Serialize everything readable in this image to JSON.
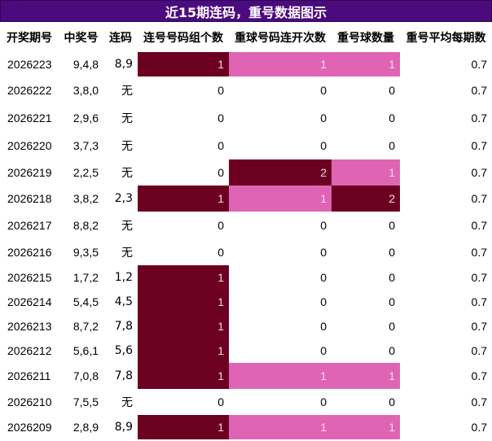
{
  "title": "近15期连码，重号数据图示",
  "columns": [
    "开奖期号",
    "中奖号",
    "连码",
    "连号号码组个数",
    "重球号码连开次数",
    "重号球数量",
    "重号平均每期数"
  ],
  "rows": [
    {
      "issue": "2026223",
      "numbers": "9,4,8",
      "consec": "8,9",
      "consec_groups": "1",
      "repeat_runs": "1",
      "repeat_count": "1",
      "repeat_avg": "0.7",
      "hl": [
        "dark",
        "pink",
        "pink"
      ]
    },
    {
      "issue": "2026222",
      "numbers": "3,8,0",
      "consec": "无",
      "consec_groups": "0",
      "repeat_runs": "0",
      "repeat_count": "0",
      "repeat_avg": "0.7",
      "hl": [
        "",
        "",
        ""
      ]
    },
    {
      "issue": "2026221",
      "numbers": "2,9,6",
      "consec": "无",
      "consec_groups": "0",
      "repeat_runs": "0",
      "repeat_count": "0",
      "repeat_avg": "0.7",
      "hl": [
        "",
        "",
        ""
      ]
    },
    {
      "issue": "2026220",
      "numbers": "3,7,3",
      "consec": "无",
      "consec_groups": "0",
      "repeat_runs": "0",
      "repeat_count": "0",
      "repeat_avg": "0.7",
      "hl": [
        "",
        "",
        ""
      ]
    },
    {
      "issue": "2026219",
      "numbers": "2,2,5",
      "consec": "无",
      "consec_groups": "0",
      "repeat_runs": "2",
      "repeat_count": "1",
      "repeat_avg": "0.7",
      "hl": [
        "",
        "dark",
        "pink"
      ]
    },
    {
      "issue": "2026218",
      "numbers": "3,8,2",
      "consec": "2,3",
      "consec_groups": "1",
      "repeat_runs": "1",
      "repeat_count": "2",
      "repeat_avg": "0.7",
      "hl": [
        "dark",
        "pink",
        "dark"
      ]
    },
    {
      "issue": "2026217",
      "numbers": "8,8,2",
      "consec": "无",
      "consec_groups": "0",
      "repeat_runs": "0",
      "repeat_count": "0",
      "repeat_avg": "0.7",
      "hl": [
        "",
        "",
        ""
      ]
    },
    {
      "issue": "2026216",
      "numbers": "9,3,5",
      "consec": "无",
      "consec_groups": "0",
      "repeat_runs": "0",
      "repeat_count": "0",
      "repeat_avg": "0.7",
      "hl": [
        "",
        "",
        ""
      ]
    },
    {
      "issue": "2026215",
      "numbers": "1,7,2",
      "consec": "1,2",
      "consec_groups": "1",
      "repeat_runs": "0",
      "repeat_count": "0",
      "repeat_avg": "0.7",
      "hl": [
        "dark",
        "",
        ""
      ]
    },
    {
      "issue": "2026214",
      "numbers": "5,4,5",
      "consec": "4,5",
      "consec_groups": "1",
      "repeat_runs": "0",
      "repeat_count": "0",
      "repeat_avg": "0.7",
      "hl": [
        "dark",
        "",
        ""
      ]
    },
    {
      "issue": "2026213",
      "numbers": "8,7,2",
      "consec": "7,8",
      "consec_groups": "1",
      "repeat_runs": "0",
      "repeat_count": "0",
      "repeat_avg": "0.7",
      "hl": [
        "dark",
        "",
        ""
      ]
    },
    {
      "issue": "2026212",
      "numbers": "5,6,1",
      "consec": "5,6",
      "consec_groups": "1",
      "repeat_runs": "0",
      "repeat_count": "0",
      "repeat_avg": "0.7",
      "hl": [
        "dark",
        "",
        ""
      ]
    },
    {
      "issue": "2026211",
      "numbers": "7,0,8",
      "consec": "7,8",
      "consec_groups": "1",
      "repeat_runs": "1",
      "repeat_count": "1",
      "repeat_avg": "0.7",
      "hl": [
        "dark",
        "pink",
        "pink"
      ]
    },
    {
      "issue": "2026210",
      "numbers": "7,5,5",
      "consec": "无",
      "consec_groups": "0",
      "repeat_runs": "0",
      "repeat_count": "0",
      "repeat_avg": "0.7",
      "hl": [
        "",
        "",
        ""
      ]
    },
    {
      "issue": "2026209",
      "numbers": "2,8,9",
      "consec": "8,9",
      "consec_groups": "1",
      "repeat_runs": "1",
      "repeat_count": "1",
      "repeat_avg": "0.7",
      "hl": [
        "dark",
        "pink",
        "pink"
      ]
    }
  ],
  "colors": {
    "title_bg": "#4b0a7d",
    "dark_cell": "#6b0020",
    "pink_cell": "#df64b4"
  }
}
